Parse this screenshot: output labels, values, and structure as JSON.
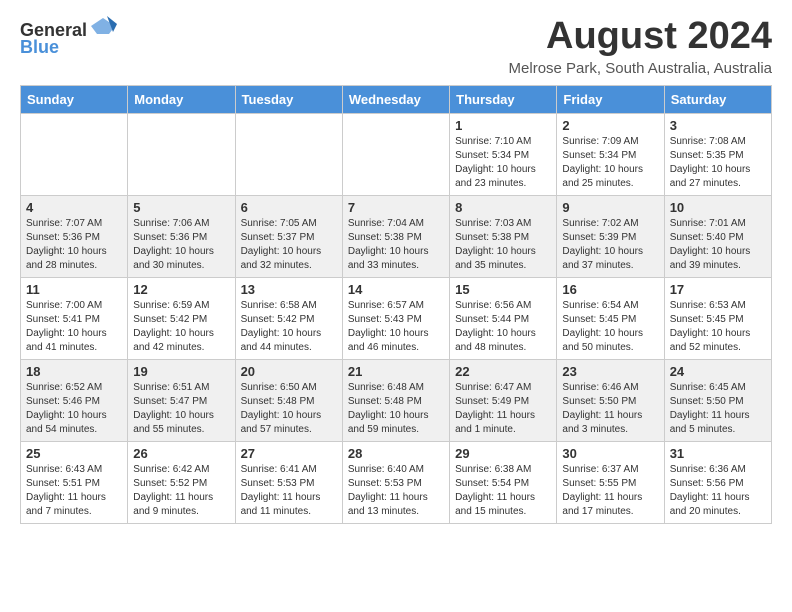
{
  "header": {
    "logo_general": "General",
    "logo_blue": "Blue",
    "main_title": "August 2024",
    "subtitle": "Melrose Park, South Australia, Australia"
  },
  "calendar": {
    "days_of_week": [
      "Sunday",
      "Monday",
      "Tuesday",
      "Wednesday",
      "Thursday",
      "Friday",
      "Saturday"
    ],
    "weeks": [
      [
        {
          "day": "",
          "info": ""
        },
        {
          "day": "",
          "info": ""
        },
        {
          "day": "",
          "info": ""
        },
        {
          "day": "",
          "info": ""
        },
        {
          "day": "1",
          "info": "Sunrise: 7:10 AM\nSunset: 5:34 PM\nDaylight: 10 hours\nand 23 minutes."
        },
        {
          "day": "2",
          "info": "Sunrise: 7:09 AM\nSunset: 5:34 PM\nDaylight: 10 hours\nand 25 minutes."
        },
        {
          "day": "3",
          "info": "Sunrise: 7:08 AM\nSunset: 5:35 PM\nDaylight: 10 hours\nand 27 minutes."
        }
      ],
      [
        {
          "day": "4",
          "info": "Sunrise: 7:07 AM\nSunset: 5:36 PM\nDaylight: 10 hours\nand 28 minutes."
        },
        {
          "day": "5",
          "info": "Sunrise: 7:06 AM\nSunset: 5:36 PM\nDaylight: 10 hours\nand 30 minutes."
        },
        {
          "day": "6",
          "info": "Sunrise: 7:05 AM\nSunset: 5:37 PM\nDaylight: 10 hours\nand 32 minutes."
        },
        {
          "day": "7",
          "info": "Sunrise: 7:04 AM\nSunset: 5:38 PM\nDaylight: 10 hours\nand 33 minutes."
        },
        {
          "day": "8",
          "info": "Sunrise: 7:03 AM\nSunset: 5:38 PM\nDaylight: 10 hours\nand 35 minutes."
        },
        {
          "day": "9",
          "info": "Sunrise: 7:02 AM\nSunset: 5:39 PM\nDaylight: 10 hours\nand 37 minutes."
        },
        {
          "day": "10",
          "info": "Sunrise: 7:01 AM\nSunset: 5:40 PM\nDaylight: 10 hours\nand 39 minutes."
        }
      ],
      [
        {
          "day": "11",
          "info": "Sunrise: 7:00 AM\nSunset: 5:41 PM\nDaylight: 10 hours\nand 41 minutes."
        },
        {
          "day": "12",
          "info": "Sunrise: 6:59 AM\nSunset: 5:42 PM\nDaylight: 10 hours\nand 42 minutes."
        },
        {
          "day": "13",
          "info": "Sunrise: 6:58 AM\nSunset: 5:42 PM\nDaylight: 10 hours\nand 44 minutes."
        },
        {
          "day": "14",
          "info": "Sunrise: 6:57 AM\nSunset: 5:43 PM\nDaylight: 10 hours\nand 46 minutes."
        },
        {
          "day": "15",
          "info": "Sunrise: 6:56 AM\nSunset: 5:44 PM\nDaylight: 10 hours\nand 48 minutes."
        },
        {
          "day": "16",
          "info": "Sunrise: 6:54 AM\nSunset: 5:45 PM\nDaylight: 10 hours\nand 50 minutes."
        },
        {
          "day": "17",
          "info": "Sunrise: 6:53 AM\nSunset: 5:45 PM\nDaylight: 10 hours\nand 52 minutes."
        }
      ],
      [
        {
          "day": "18",
          "info": "Sunrise: 6:52 AM\nSunset: 5:46 PM\nDaylight: 10 hours\nand 54 minutes."
        },
        {
          "day": "19",
          "info": "Sunrise: 6:51 AM\nSunset: 5:47 PM\nDaylight: 10 hours\nand 55 minutes."
        },
        {
          "day": "20",
          "info": "Sunrise: 6:50 AM\nSunset: 5:48 PM\nDaylight: 10 hours\nand 57 minutes."
        },
        {
          "day": "21",
          "info": "Sunrise: 6:48 AM\nSunset: 5:48 PM\nDaylight: 10 hours\nand 59 minutes."
        },
        {
          "day": "22",
          "info": "Sunrise: 6:47 AM\nSunset: 5:49 PM\nDaylight: 11 hours\nand 1 minute."
        },
        {
          "day": "23",
          "info": "Sunrise: 6:46 AM\nSunset: 5:50 PM\nDaylight: 11 hours\nand 3 minutes."
        },
        {
          "day": "24",
          "info": "Sunrise: 6:45 AM\nSunset: 5:50 PM\nDaylight: 11 hours\nand 5 minutes."
        }
      ],
      [
        {
          "day": "25",
          "info": "Sunrise: 6:43 AM\nSunset: 5:51 PM\nDaylight: 11 hours\nand 7 minutes."
        },
        {
          "day": "26",
          "info": "Sunrise: 6:42 AM\nSunset: 5:52 PM\nDaylight: 11 hours\nand 9 minutes."
        },
        {
          "day": "27",
          "info": "Sunrise: 6:41 AM\nSunset: 5:53 PM\nDaylight: 11 hours\nand 11 minutes."
        },
        {
          "day": "28",
          "info": "Sunrise: 6:40 AM\nSunset: 5:53 PM\nDaylight: 11 hours\nand 13 minutes."
        },
        {
          "day": "29",
          "info": "Sunrise: 6:38 AM\nSunset: 5:54 PM\nDaylight: 11 hours\nand 15 minutes."
        },
        {
          "day": "30",
          "info": "Sunrise: 6:37 AM\nSunset: 5:55 PM\nDaylight: 11 hours\nand 17 minutes."
        },
        {
          "day": "31",
          "info": "Sunrise: 6:36 AM\nSunset: 5:56 PM\nDaylight: 11 hours\nand 20 minutes."
        }
      ]
    ]
  }
}
